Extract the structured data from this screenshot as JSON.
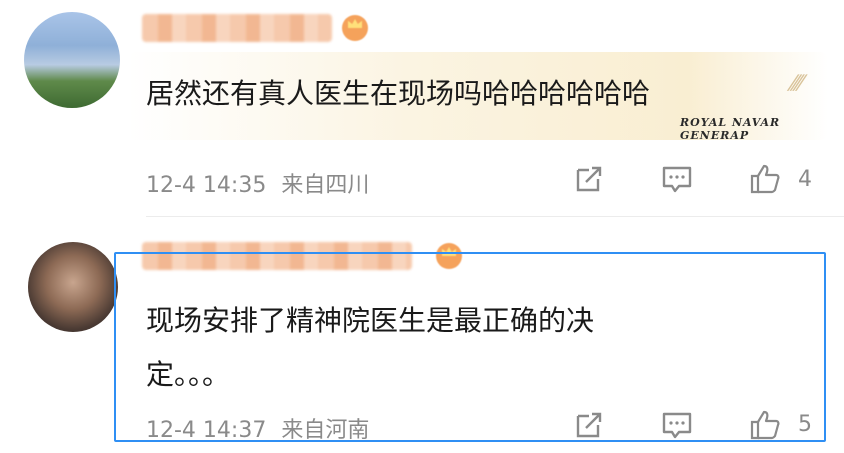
{
  "comments": [
    {
      "text": "居然还有真人医生在现场吗哈哈哈哈哈哈",
      "date": "12-4 14:35",
      "source": "来自四川",
      "likes": "4",
      "signature": "ROYAL NAVAR GENERAP"
    },
    {
      "text_line1": "现场安排了精神院医生是最正确的决",
      "text_line2": "定。。。",
      "date": "12-4 14:37",
      "source": "来自河南",
      "likes": "5"
    }
  ],
  "colors": {
    "highlight": "#2f8ff4",
    "meta_text": "#8a8a8a",
    "username_blur": "#f2b48d"
  },
  "icons": [
    "share-icon",
    "comment-icon",
    "like-icon",
    "vip-crown-icon"
  ]
}
